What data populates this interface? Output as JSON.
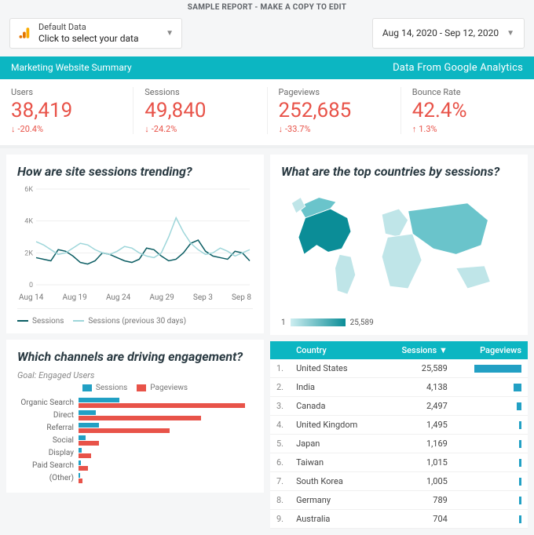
{
  "top_note": "SAMPLE REPORT - MAKE A COPY TO EDIT",
  "data_source": {
    "name": "Default Data",
    "hint": "Click to select your data"
  },
  "date_range": "Aug 14, 2020 - Sep 12, 2020",
  "teal_bar": {
    "left": "Marketing Website Summary",
    "right": "Data From Google Analytics"
  },
  "kpis": [
    {
      "label": "Users",
      "value": "38,419",
      "delta": "-20.4%",
      "dir": "down"
    },
    {
      "label": "Sessions",
      "value": "49,840",
      "delta": "-24.2%",
      "dir": "down"
    },
    {
      "label": "Pageviews",
      "value": "252,685",
      "delta": "-33.7%",
      "dir": "down"
    },
    {
      "label": "Bounce Rate",
      "value": "42.4%",
      "delta": "1.3%",
      "dir": "up"
    }
  ],
  "sessions_chart_title": "How are site sessions trending?",
  "countries_chart_title": "What are the top countries by sessions?",
  "channels_chart_title": "Which channels are driving engagement?",
  "channels_goal": "Goal: Engaged Users",
  "legend": {
    "sessions": "Sessions",
    "sessions_prev": "Sessions (previous 30 days)",
    "pageviews": "Pageviews"
  },
  "map_scale": {
    "min": "1",
    "max": "25,589"
  },
  "country_table": {
    "headers": {
      "country": "Country",
      "sessions": "Sessions",
      "pageviews": "Pageviews"
    }
  },
  "chart_data": [
    {
      "id": "sessions_trend",
      "type": "line",
      "title": "How are site sessions trending?",
      "xlabel": "",
      "ylabel": "",
      "ylim": [
        0,
        6000
      ],
      "yticks": [
        0,
        2000,
        4000,
        6000
      ],
      "x": [
        "Aug 14",
        "Aug 19",
        "Aug 24",
        "Aug 29",
        "Sep 3",
        "Sep 8"
      ],
      "series": [
        {
          "name": "Sessions",
          "values_daily": [
            1700,
            1600,
            1500,
            2200,
            2100,
            1800,
            1400,
            1300,
            1500,
            2000,
            1900,
            1700,
            1500,
            1400,
            1600,
            2300,
            2200,
            1800,
            1500,
            1600,
            2000,
            2600,
            2800,
            2100,
            1800,
            1700,
            1600,
            2100,
            2000,
            1500
          ]
        },
        {
          "name": "Sessions (previous 30 days)",
          "values_daily": [
            2700,
            2500,
            2200,
            1900,
            2000,
            2300,
            2600,
            2500,
            2200,
            2000,
            1900,
            2100,
            2400,
            2300,
            2000,
            1800,
            1700,
            2000,
            3000,
            4200,
            3300,
            2600,
            2200,
            1900,
            2000,
            2300,
            2100,
            1800,
            2000,
            2200
          ]
        }
      ]
    },
    {
      "id": "countries_map",
      "type": "choropleth",
      "title": "What are the top countries by sessions?",
      "scale": [
        1,
        25589
      ],
      "rows": [
        {
          "rank": 1,
          "country": "United States",
          "sessions": 25589
        },
        {
          "rank": 2,
          "country": "India",
          "sessions": 4138
        },
        {
          "rank": 3,
          "country": "Canada",
          "sessions": 2497
        },
        {
          "rank": 4,
          "country": "United Kingdom",
          "sessions": 1495
        },
        {
          "rank": 5,
          "country": "Japan",
          "sessions": 1169
        },
        {
          "rank": 6,
          "country": "Taiwan",
          "sessions": 1015
        },
        {
          "rank": 7,
          "country": "South Korea",
          "sessions": 1005
        },
        {
          "rank": 8,
          "country": "Germany",
          "sessions": 789
        },
        {
          "rank": 9,
          "country": "Australia",
          "sessions": 704
        }
      ]
    },
    {
      "id": "channels",
      "type": "bar",
      "orientation": "horizontal",
      "title": "Which channels are driving engagement?",
      "categories": [
        "Organic Search",
        "Direct",
        "Referral",
        "Social",
        "Display",
        "Paid Search",
        "(Other)"
      ],
      "series": [
        {
          "name": "Sessions",
          "values": [
            5200,
            2200,
            2600,
            900,
            400,
            300,
            150
          ]
        },
        {
          "name": "Pageviews",
          "values": [
            21000,
            15500,
            11500,
            2600,
            1600,
            1200,
            500
          ]
        }
      ],
      "xlim": [
        0,
        22000
      ]
    }
  ]
}
